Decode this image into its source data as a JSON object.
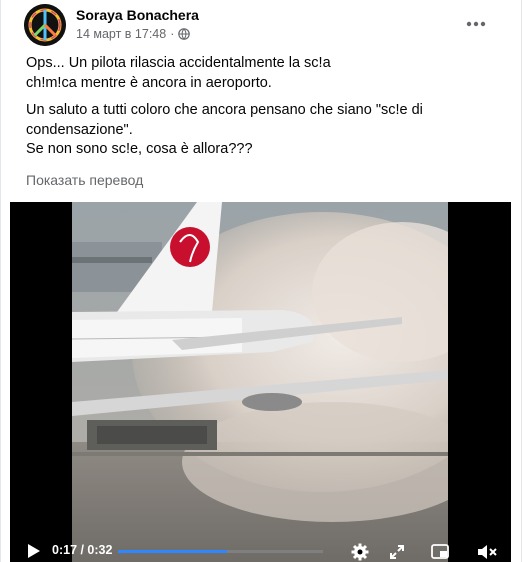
{
  "post": {
    "author": "Soraya Bonachera",
    "timestamp": "14 март в 17:48",
    "separator": "·",
    "privacy_icon": "globe-icon",
    "more_icon": "more-options-icon",
    "paragraph1_line1": "Ops... Un pilota rilascia accidentalmente la sc!a",
    "paragraph1_line2": "ch!m!ca mentre è ancora in aeroporto.",
    "paragraph2_line1": "Un saluto a tutti coloro che ancora pensano che siano \"sc!e di",
    "paragraph2_line2": "condensazione\".",
    "paragraph2_line3": "Se non sono sc!e, cosa è allora???",
    "translate_label": "Показать перевод"
  },
  "video": {
    "current_time": "0:17",
    "duration": "0:32",
    "time_display": "0:17 / 0:32",
    "progress_fraction": 0.53,
    "accent_color": "#2d88ff",
    "icons": [
      "play-icon",
      "settings-icon",
      "expand-icon",
      "picture-in-picture-icon",
      "mute-icon"
    ]
  }
}
